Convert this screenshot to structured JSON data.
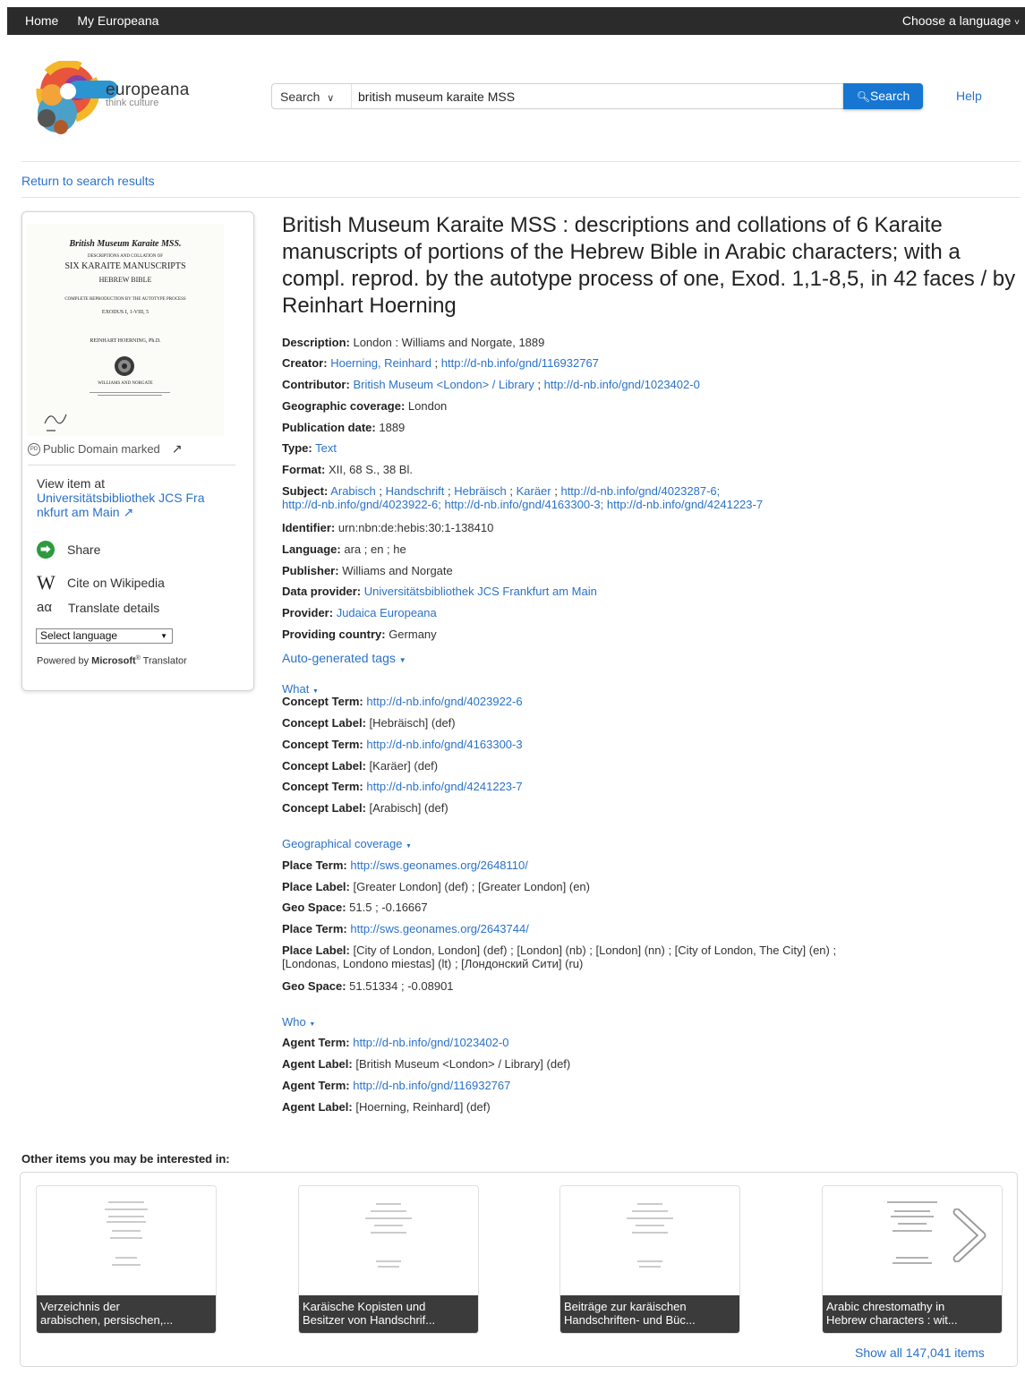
{
  "topbar": {
    "home": "Home",
    "my_europeana": "My Europeana",
    "language": "Choose a language"
  },
  "logo": {
    "name": "europeana",
    "tagline": "think culture"
  },
  "search": {
    "type_label": "Search",
    "query": "british museum karaite MSS",
    "button": "Search",
    "help": "Help"
  },
  "return_link": "Return to search results",
  "thumbnail": {
    "lines": [
      "British Museum Karaite MSS.",
      "DESCRIPTIONS AND COLLATION OF",
      "SIX KARAITE MANUSCRIPTS",
      "HEBREW BIBLE",
      "COMPLETE REPRODUCTION BY THE AUTOTYPE PROCESS",
      "EXODUS I, 1-VIII, 5",
      "REINHART HOERNING, Ph.D.",
      "WILLIAMS AND NORGATE"
    ]
  },
  "sidebar": {
    "license": "Public Domain marked",
    "view_at": "View item at",
    "view_at_link_1": "Universitätsbibliothek JCS Fra",
    "view_at_link_2": "nkfurt am Main",
    "share": "Share",
    "wiki": "Cite on Wikipedia",
    "translate": "Translate details",
    "select_language": "Select language",
    "powered_prefix": "Powered by ",
    "powered_brand": "Microsoft",
    "powered_suffix": " Translator"
  },
  "record": {
    "title": "British Museum Karaite MSS : descriptions and collations of 6 Karaite manuscripts of portions of the Hebrew Bible in Arabic characters; with a compl. reprod. by the autotype process of one, Exod. 1,1-8,5, in 42 faces / by Reinhart Hoerning",
    "description_label": "Description:",
    "description": "London : Williams and Norgate, 1889",
    "creator_label": "Creator:",
    "creator_1": "Hoerning, Reinhard",
    "creator_2": "http://d-nb.info/gnd/116932767",
    "contributor_label": "Contributor:",
    "contributor_1": "British Museum <London> / Library",
    "contributor_2": "http://d-nb.info/gnd/1023402-0",
    "geo_label": "Geographic coverage:",
    "geo": "London",
    "pubdate_label": "Publication date:",
    "pubdate": "1889",
    "type_label": "Type:",
    "type": "Text",
    "format_label": "Format:",
    "format": "XII, 68 S., 38 Bl.",
    "subject_label": "Subject:",
    "subject_line1": [
      "Arabisch",
      "Handschrift",
      "Hebräisch",
      "Karäer",
      "http://d-nb.info/gnd/4023287-6;"
    ],
    "subject_line2": [
      "http://d-nb.info/gnd/4023922-6;",
      "http://d-nb.info/gnd/4163300-3;",
      "http://d-nb.info/gnd/4241223-7"
    ],
    "identifier_label": "Identifier:",
    "identifier": "urn:nbn:de:hebis:30:1-138410",
    "language_label": "Language:",
    "language": "ara ; en ; he",
    "publisher_label": "Publisher:",
    "publisher": "Williams and Norgate",
    "dataprovider_label": "Data provider:",
    "dataprovider": "Universitätsbibliothek JCS Frankfurt am Main",
    "provider_label": "Provider:",
    "provider": "Judaica Europeana",
    "country_label": "Providing country:",
    "country": "Germany",
    "autotags": "Auto-generated tags"
  },
  "what": {
    "toggle": "What",
    "rows": [
      {
        "label": "Concept Term:",
        "value": "http://d-nb.info/gnd/4023922-6",
        "link": true
      },
      {
        "label": "Concept Label:",
        "value": "[Hebräisch] (def)",
        "link": false
      },
      {
        "label": "Concept Term:",
        "value": "http://d-nb.info/gnd/4163300-3",
        "link": true
      },
      {
        "label": "Concept Label:",
        "value": "[Karäer] (def)",
        "link": false
      },
      {
        "label": "Concept Term:",
        "value": "http://d-nb.info/gnd/4241223-7",
        "link": true
      },
      {
        "label": "Concept Label:",
        "value": "[Arabisch] (def)",
        "link": false
      }
    ]
  },
  "geographical": {
    "toggle": "Geographical coverage",
    "place_term_label": "Place Term:",
    "place_term_1": "http://sws.geonames.org/2648110/",
    "place_label_label": "Place Label:",
    "place_label_1": "[Greater London] (def) ; [Greater London] (en)",
    "geo_space_label": "Geo Space:",
    "geo_space_1": "51.5 ; -0.16667",
    "place_term_2": "http://sws.geonames.org/2643744/",
    "place_label_2a": "[City of London, London] (def) ; [London] (nb) ; [London] (nn) ; [City of London, The City] (en) ;",
    "place_label_2b": "[Londonas, Londono miestas] (lt) ; [Лондонский Сити] (ru)",
    "geo_space_2": "51.51334 ; -0.08901"
  },
  "who": {
    "toggle": "Who",
    "rows": [
      {
        "label": "Agent Term:",
        "value": "http://d-nb.info/gnd/1023402-0",
        "link": true
      },
      {
        "label": "Agent Label:",
        "value": "[British Museum <London> / Library] (def)",
        "link": false
      },
      {
        "label": "Agent Term:",
        "value": "http://d-nb.info/gnd/116932767",
        "link": true
      },
      {
        "label": "Agent Label:",
        "value": "[Hoerning, Reinhard] (def)",
        "link": false
      }
    ]
  },
  "related": {
    "heading": "Other items you may be interested in:",
    "items": [
      {
        "line1": "Verzeichnis der",
        "line2": "arabischen, persischen,..."
      },
      {
        "line1": "Karäische Kopisten und",
        "line2": "Besitzer von Handschrif..."
      },
      {
        "line1": "Beiträge zur karäischen",
        "line2": "Handschriften- und Büc..."
      },
      {
        "line1": "Arabic chrestomathy in",
        "line2": "Hebrew characters : wit..."
      }
    ],
    "show_all": "Show all 147,041 items"
  },
  "colors": {
    "link": "#2a72c9",
    "topbar": "#2b2b2b",
    "search_button": "#1676d2",
    "share_icon": "#2c9a3e"
  }
}
